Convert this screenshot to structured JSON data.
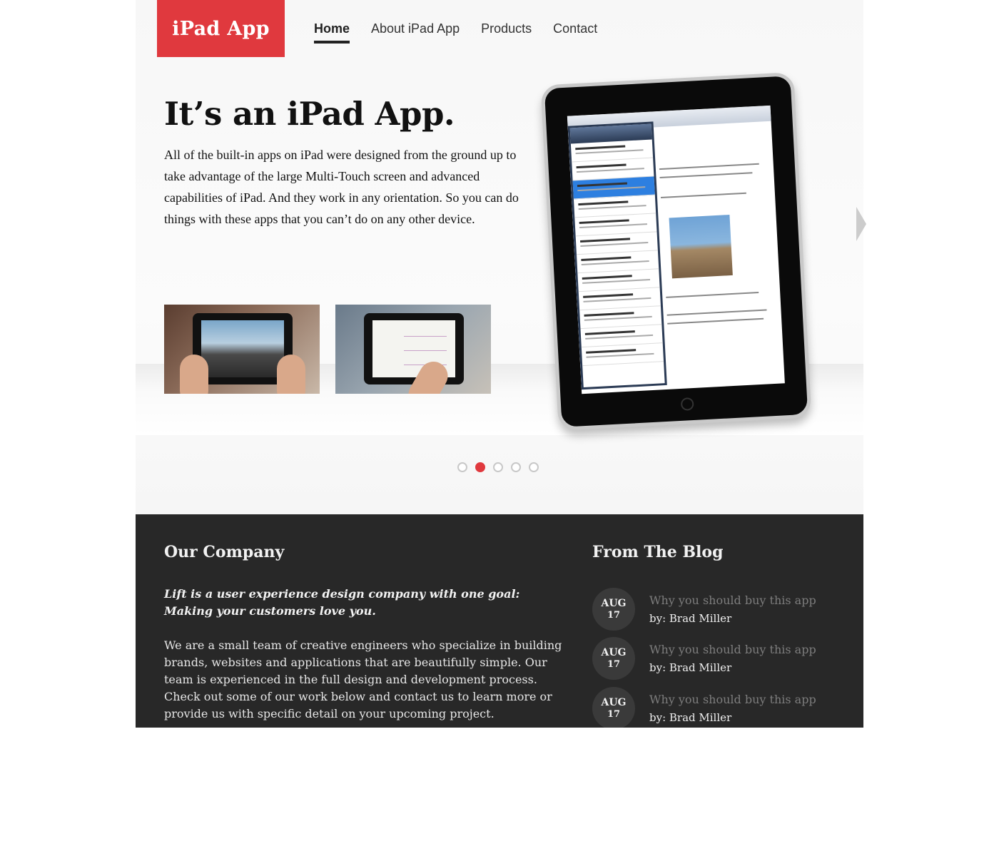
{
  "header": {
    "logo": "iPad App",
    "nav": [
      {
        "label": "Home",
        "active": true
      },
      {
        "label": "About iPad App",
        "active": false
      },
      {
        "label": "Products",
        "active": false
      },
      {
        "label": "Contact",
        "active": false
      }
    ]
  },
  "hero": {
    "title": "It’s an iPad App.",
    "text": "All of the built-in apps on iPad were designed from the ground up to take advantage of the large Multi-Touch screen and advanced capabilities of iPad. And they work in any orientation. So you can do things with these apps that you can’t do on any other device.",
    "slider": {
      "total": 5,
      "active_index": 1
    }
  },
  "company": {
    "title": "Our Company",
    "lead": "Lift is a user experience design company with one goal: Making your customers love you.",
    "body": "We are a small team of creative engineers who specialize in building brands, websites and applications that are beautifully simple. Our team is experienced in the full design and development process. Check out some of our work below and contact us to learn more or provide us with specific detail on your upcoming project."
  },
  "blog": {
    "title": "From The Blog",
    "posts": [
      {
        "month": "AUG",
        "day": "17",
        "title": "Why you should buy this app",
        "author": "by: Brad Miller"
      },
      {
        "month": "AUG",
        "day": "17",
        "title": "Why you should buy this app",
        "author": "by: Brad Miller"
      },
      {
        "month": "AUG",
        "day": "17",
        "title": "Why you should buy this app",
        "author": "by: Brad Miller"
      }
    ]
  },
  "colors": {
    "accent": "#e0393e",
    "dark_bg": "#282828",
    "blog_title": "#7d7d7d"
  }
}
